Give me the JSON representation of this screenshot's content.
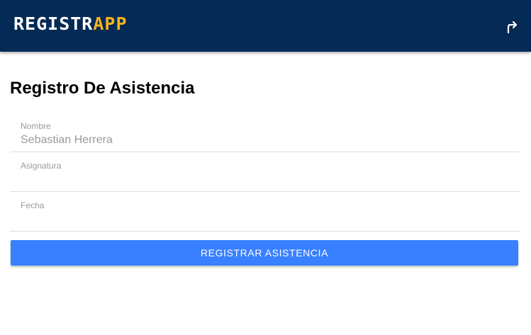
{
  "app": {
    "logo_part1": "REGISTR",
    "logo_part2": "APP",
    "logout_icon": "logout-arrow-icon",
    "header_color": "#042a55",
    "logo_accent_color": "#f5b31c"
  },
  "page": {
    "title": "Registro De Asistencia"
  },
  "form": {
    "fields": [
      {
        "label": "Nombre",
        "value": "Sebastian Herrera",
        "placeholder": ""
      },
      {
        "label": "Asignatura",
        "value": "",
        "placeholder": ""
      },
      {
        "label": "Fecha",
        "value": "",
        "placeholder": ""
      }
    ],
    "submit_label": "REGISTRAR ASISTENCIA",
    "submit_color": "#3880ff"
  }
}
